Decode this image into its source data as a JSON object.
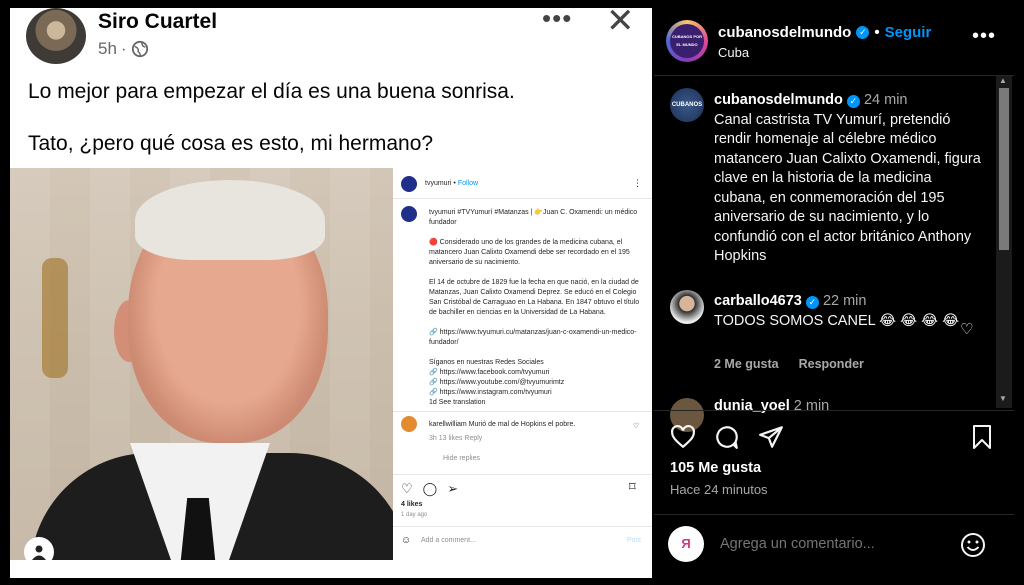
{
  "facebook": {
    "author": "Siro Cuartel",
    "time": "5h",
    "more": "•••",
    "close": "✕",
    "text_line1": "Lo mejor para empezar el día es una buena sonrisa.",
    "text_line2": "Tato, ¿pero qué cosa es esto, mi hermano?"
  },
  "embedded_post": {
    "account": "tvyumuri",
    "follow": "Follow",
    "caption": "tvyumuri #TVYumurí #Matanzas | 👉Juan C. Oxamendi: un médico fundador\n\n🔴 Considerado uno de los grandes de la medicina cubana, el matancero Juan Calixto Oxamendi debe ser recordado en el 195 aniversario de su nacimiento.\n\nEl 14 de octubre de 1829 fue la fecha en que nació, en la ciudad de Matanzas, Juan Calixto Oxamendi Deprez. Se educó en el Colegio San Cristóbal de Carraguao en La Habana. En 1847 obtuvo el título de bachiller en ciencias en la Universidad de La Habana.\n\n🔗 https://www.tvyumuri.cu/matanzas/juan-c-oxamendi-un-medico-fundador/\n\nSíganos en nuestras Redes Sociales\n🔗 https://www.facebook.com/tvyumuri\n🔗 https://www.youtube.com/@tvyumurimtz\n🔗 https://www.instagram.com/tvyumuri\n1d   See translation",
    "comment": "karellwilliam Murió de mal de Hopkins el pobre.",
    "comment_meta": "3h   13 likes   Reply",
    "hide_replies": "Hide replies",
    "likes": "4 likes",
    "ago": "1 day ago",
    "add_comment": "Add a comment...",
    "post_label": "Post"
  },
  "instagram": {
    "account": "cubanosdelmundo",
    "follow": "Seguir",
    "location": "Cuba",
    "avatar_text": "CUBANOS POR EL MUNDO",
    "caption_user": "cubanosdelmundo",
    "caption_time": "24 min",
    "caption_text": "Canal castrista TV Yumurí, pretendió rendir homenaje al célebre médico matancero Juan Calixto Oxamendi, figura clave en la historia de la medicina cubana, en conmemoración del 195 aniversario de su nacimiento, y lo confundió con el actor británico Anthony Hopkins",
    "comment_user": "carballo4673",
    "comment_time": "22 min",
    "comment_text": "TODOS SOMOS CANEL 😂 😂 😂 😂",
    "comment_likes": "2 Me gusta",
    "comment_reply": "Responder",
    "next_comment_user": "dunia_yoel",
    "next_comment_time": "2 min",
    "likes": "105 Me gusta",
    "ago": "Hace 24 minutos",
    "add_comment_placeholder": "Agrega un comentario...",
    "current_user_initials": "Я"
  }
}
